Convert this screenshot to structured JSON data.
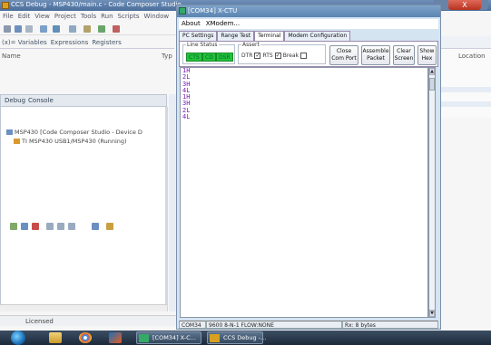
{
  "ide": {
    "title": "CCS Debug - MSP430/main.c - Code Composer Studio",
    "close_label": "X",
    "menu": [
      "File",
      "Edit",
      "View",
      "Project",
      "Tools",
      "Run",
      "Scripts",
      "Window"
    ],
    "views": {
      "variables": "(x)= Variables",
      "expressions": "Expressions",
      "registers": "Registers"
    },
    "columns": {
      "name": "Name",
      "type": "Typ",
      "location": "Location"
    },
    "debug_tabs": {
      "debug": "Debug",
      "console": "Console"
    },
    "tree": [
      "MSP430 [Code Composer Studio - Device D",
      "TI MSP430 USB1/MSP430 (Running)"
    ],
    "status": {
      "licensed": "Licensed"
    }
  },
  "terminal": {
    "title": "[COM34] X-CTU",
    "menu": [
      "About",
      "XModem..."
    ],
    "tabs": [
      "PC Settings",
      "Range Test",
      "Terminal",
      "Modem Configuration"
    ],
    "active_tab": "Terminal",
    "line_status": {
      "label": "Line Status",
      "indicators": [
        "CTS",
        "CD",
        "DSR"
      ],
      "color": "#23c23a"
    },
    "assert": {
      "label": "Assert",
      "items": [
        {
          "label": "DTR",
          "checked": true
        },
        {
          "label": "RTS",
          "checked": true
        },
        {
          "label": "Break",
          "checked": false
        }
      ]
    },
    "buttons": {
      "close_com": [
        "Close",
        "Com Port"
      ],
      "assemble": [
        "Assemble",
        "Packet"
      ],
      "clear": [
        "Clear",
        "Screen"
      ],
      "show_hex": [
        "Show",
        "Hex"
      ]
    },
    "output_lines": [
      "1H",
      "2L",
      "3H",
      "4L",
      "1H",
      "3H",
      "2L",
      "4L"
    ],
    "output_color": "#7a1ab8",
    "status": {
      "port": "COM34",
      "settings": "9600 8-N-1  FLOW:NONE",
      "rx": "Rx: 8 bytes"
    }
  },
  "taskbar": {
    "tasks": [
      {
        "label": "[COM34] X-C..."
      },
      {
        "label": "CCS Debug -..."
      }
    ]
  }
}
